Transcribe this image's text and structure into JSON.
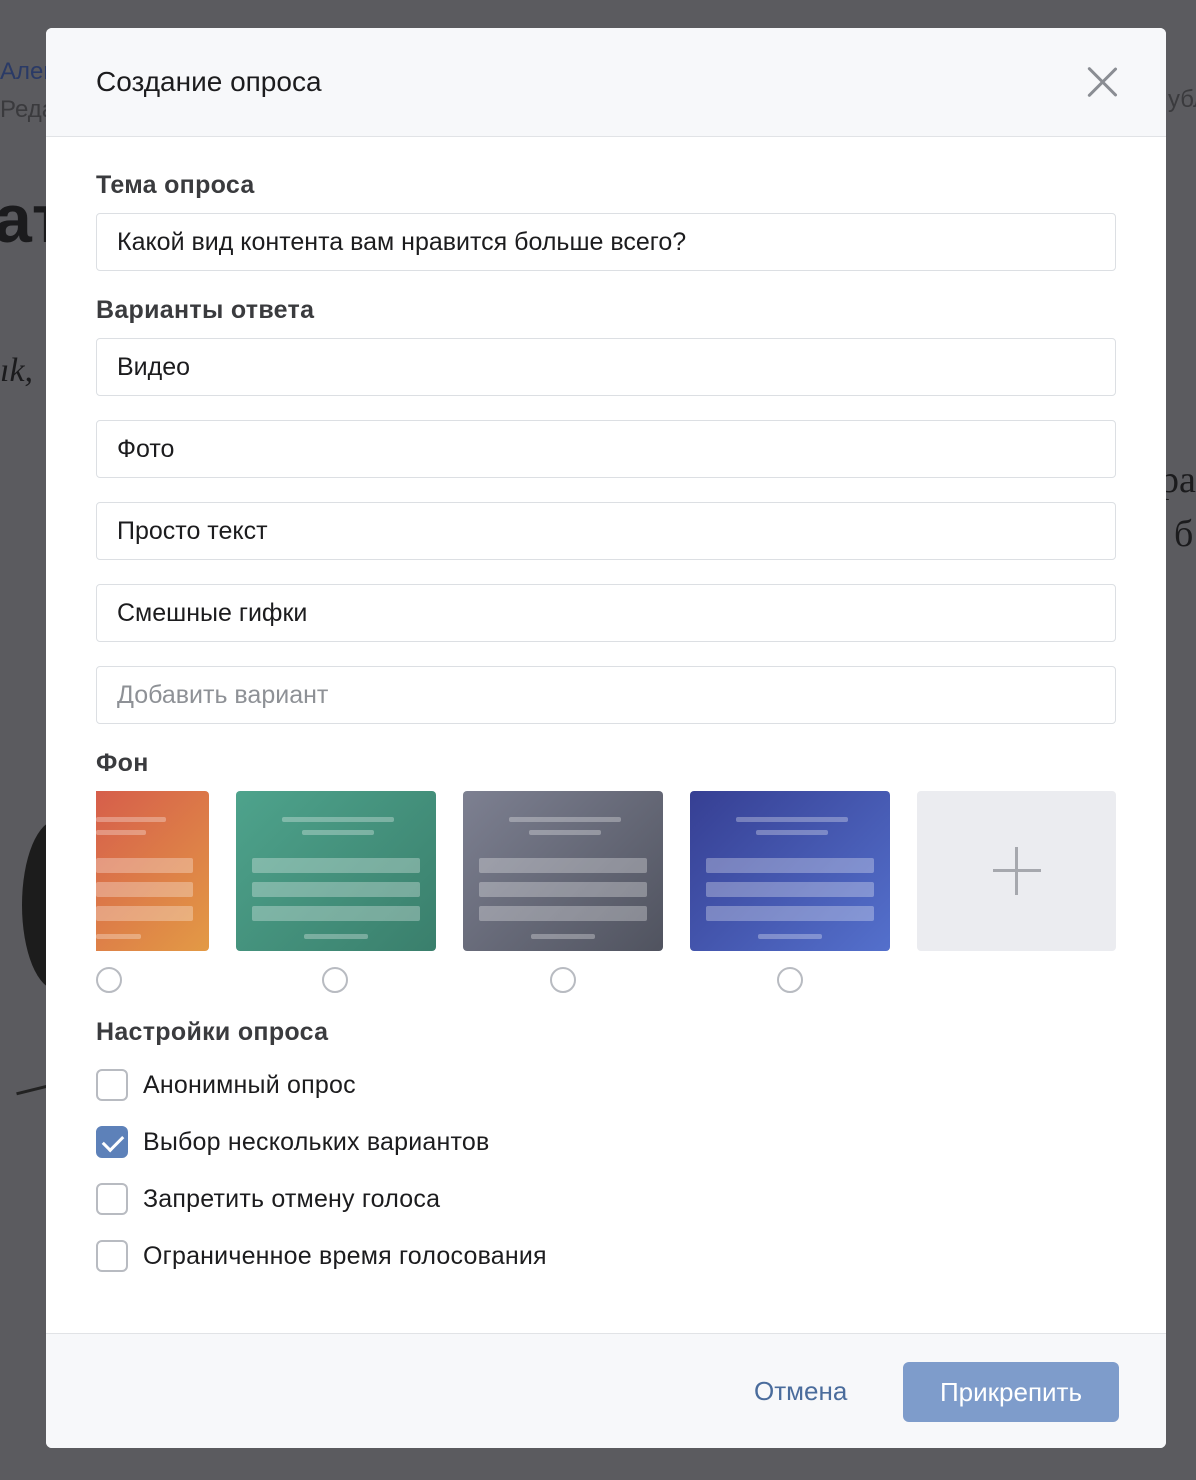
{
  "background_page": {
    "author_fragment": "Алек",
    "role_fragment": "Реда",
    "headline_fragment": "ат",
    "italic_fragment": "ık,",
    "right_fragment_1": "убл",
    "right_fragment_2": "ра",
    "right_fragment_3": "б"
  },
  "modal": {
    "title": "Создание опроса",
    "close_icon": "close-icon"
  },
  "topic": {
    "label": "Тема опроса",
    "value": "Какой вид контента вам нравится больше всего?"
  },
  "answers": {
    "label": "Варианты ответа",
    "options": [
      "Видео",
      "Фото",
      "Просто текст",
      "Смешные гифки"
    ],
    "add_placeholder": "Добавить вариант"
  },
  "background": {
    "label": "Фон",
    "tiles": [
      {
        "name": "orange",
        "colors": [
          "#d65e4b",
          "#e39a45"
        ],
        "selected": false
      },
      {
        "name": "green",
        "colors": [
          "#4ea38c",
          "#3a7f6c"
        ],
        "selected": false
      },
      {
        "name": "gray",
        "colors": [
          "#7d8091",
          "#50535f"
        ],
        "selected": false
      },
      {
        "name": "blue",
        "colors": [
          "#363f93",
          "#5470cc"
        ],
        "selected": false
      }
    ],
    "add_tile_icon": "plus-icon"
  },
  "settings": {
    "label": "Настройки опроса",
    "options": [
      {
        "label": "Анонимный опрос",
        "checked": false
      },
      {
        "label": "Выбор нескольких вариантов",
        "checked": true
      },
      {
        "label": "Запретить отмену голоса",
        "checked": false
      },
      {
        "label": "Ограниченное время голосования",
        "checked": false
      }
    ]
  },
  "footer": {
    "cancel_label": "Отмена",
    "attach_label": "Прикрепить"
  },
  "colors": {
    "overlay": "#5b5b5f",
    "accent": "#5d81b9",
    "primary_button": "#7e9ccb",
    "link": "#4a6c9c"
  }
}
